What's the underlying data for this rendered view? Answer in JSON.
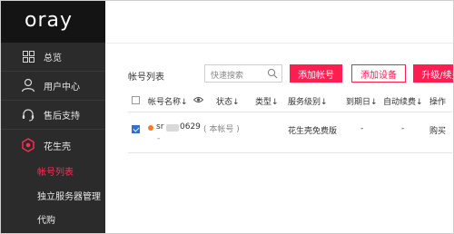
{
  "sidebar": {
    "logo": "oray",
    "items": [
      {
        "label": "总览",
        "icon": "grid-icon"
      },
      {
        "label": "用户中心",
        "icon": "user-icon"
      },
      {
        "label": "售后支持",
        "icon": "headset-icon"
      },
      {
        "label": "花生壳",
        "icon": "peanut-icon"
      }
    ],
    "sub_items": [
      {
        "label": "帐号列表",
        "active": true
      },
      {
        "label": "独立服务器管理",
        "active": false
      },
      {
        "label": "代购",
        "active": false
      }
    ]
  },
  "toolbar": {
    "title": "帐号列表",
    "search_placeholder": "快速搜索",
    "add_account": "添加帐号",
    "add_device": "添加设备",
    "upgrade_renew": "升级/续费"
  },
  "table": {
    "headers": [
      "帐号名称↓",
      "状态↓",
      "类型↓",
      "服务级别↓",
      "到期日↓",
      "自动续费↓",
      "操作"
    ],
    "rows": [
      {
        "checked": true,
        "account_prefix": "sr",
        "account_suffix": "0629",
        "account_note": "( 本帐号 )",
        "sub_text": "-",
        "status": "",
        "type": "",
        "service_level": "花生壳免费版",
        "expiry": "-",
        "auto_renew": "-",
        "action": "购买"
      }
    ]
  },
  "colors": {
    "accent": "#ff1e50",
    "sidebar_bg": "#2b2b2b",
    "logo_bg": "#141414",
    "status_dot": "#ff7a1a",
    "checkbox": "#2f6fd6"
  }
}
